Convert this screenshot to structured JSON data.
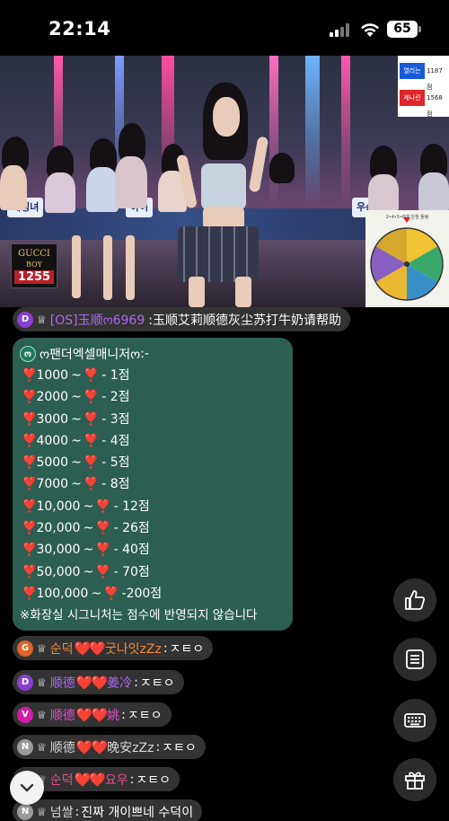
{
  "status_bar": {
    "time": "22:14",
    "battery": "65"
  },
  "video": {
    "scoreboard": [
      {
        "label": "열리는",
        "value": "1187점",
        "color": "#1a5ad8"
      },
      {
        "label": "제나린",
        "value": "1568점",
        "color": "#e0262b"
      }
    ],
    "wheel_caption": "2•4•5•6에 당첨 돌림",
    "gift_box": {
      "name": "GUCCI",
      "sub": "BOY",
      "count": "1255"
    },
    "desk_signs": [
      "계징녀",
      "하이",
      "우슨"
    ]
  },
  "chat": {
    "pinned_message": {
      "level": "D",
      "crown": "♕",
      "user": "[OS]玉顺ო6969",
      "text": ":玉顺艾莉顺德灰尘苏打牛奶请帮助"
    },
    "score_card": {
      "level": "ო",
      "user": "ო팬더엑셀매니저ო",
      "suffix": ":-",
      "rows": [
        {
          "from": "1000",
          "score": "- 1점"
        },
        {
          "from": "2000",
          "score": "- 2점"
        },
        {
          "from": "3000",
          "score": "- 3점"
        },
        {
          "from": "4000",
          "score": "- 4점"
        },
        {
          "from": "5000",
          "score": "- 5점"
        },
        {
          "from": "7000",
          "score": "- 8점"
        },
        {
          "from": "10,000",
          "score": "- 12점"
        },
        {
          "from": "20,000",
          "score": "- 26점"
        },
        {
          "from": "30,000",
          "score": "- 40점"
        },
        {
          "from": "50,000",
          "score": "- 70점"
        },
        {
          "from": "100,000",
          "score": "-200점"
        }
      ],
      "tilde": "~",
      "note": "※화장실 시그니처는 점수에 반영되지 않습니다"
    },
    "messages": [
      {
        "level": "G",
        "level_color": "#e0642a",
        "user_a": "순덕",
        "user_b": "굿나잇zZz",
        "name_color": "#f28a3c",
        "text": "ㅈㅌㅇ"
      },
      {
        "level": "D",
        "level_color": "#8a3fd2",
        "user_a": "顺德",
        "user_b": "姜冷",
        "name_color": "#b06af0",
        "text": "ㅈㅌㅇ"
      },
      {
        "level": "V",
        "level_color": "#d11ea8",
        "user_a": "顺德",
        "user_b": "姚",
        "name_color": "#e24fd0",
        "text": "ㅈㅌㅇ"
      },
      {
        "level": "N",
        "level_color": "#9a9a9a",
        "user_a": "顺德",
        "user_b": "晚安zZz",
        "name_color": "#d8d8d8",
        "text": "ㅈㅌㅇ"
      },
      {
        "level": "N",
        "level_color": "#d11ea8",
        "user_a": "순덕",
        "user_b": "요우",
        "name_color": "#e24f8c",
        "text": "ㅈㅌㅇ"
      },
      {
        "level": "N",
        "level_color": "#9a9a9a",
        "user_a": "넘쌀",
        "user_b": "",
        "name_color": "#d8d8d8",
        "text": "진짜 개이쁘네 수덕이"
      }
    ]
  },
  "actions": {
    "like_icon": "thumbs-up-icon",
    "list_icon": "list-icon",
    "keyboard_icon": "keyboard-icon",
    "gift_icon": "gift-icon"
  }
}
